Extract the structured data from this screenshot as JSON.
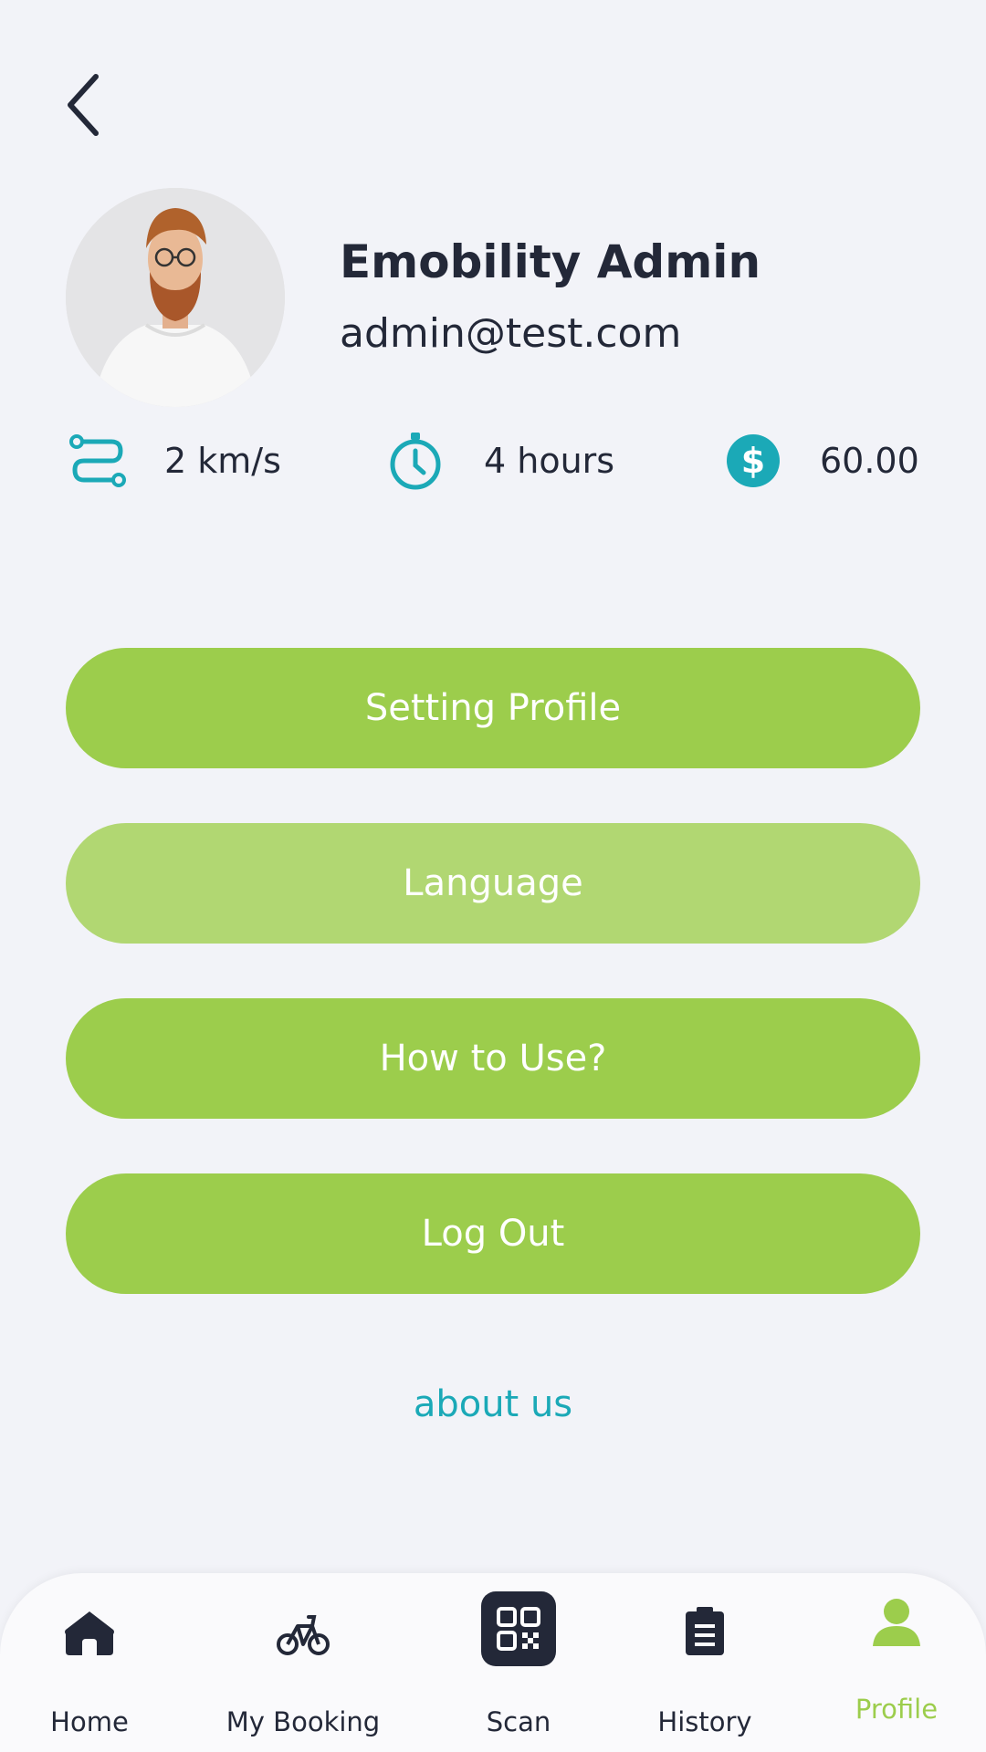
{
  "user": {
    "name": "Emobility Admin",
    "email": "admin@test.com"
  },
  "stats": {
    "distance": "2 km/s",
    "time": "4 hours",
    "balance": "60.00"
  },
  "menu": {
    "setting_profile": "Setting Profile",
    "language": "Language",
    "how_to_use": "How to Use?",
    "log_out": "Log Out"
  },
  "about_link": "about us",
  "nav": {
    "home": "Home",
    "my_booking": "My Booking",
    "scan": "Scan",
    "history": "History",
    "profile": "Profile",
    "active": "profile"
  },
  "colors": {
    "primary_green": "#9ccd4c",
    "light_green": "#b1d772",
    "teal": "#1ba9b7",
    "dark": "#232838",
    "background": "#f2f3f8"
  }
}
